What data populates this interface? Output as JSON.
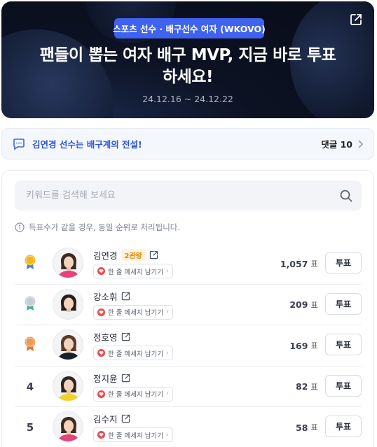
{
  "hero": {
    "category": "스포츠 선수 · 배구선수 여자 (WKOVO)",
    "title_line1": "팬들이 뽑는 여자 배구 MVP, 지금 바로 투표",
    "title_line2": "하세요!",
    "dates": "24.12.16 ~ 24.12.22"
  },
  "comment_bar": {
    "text": "김연경 선수는 배구계의 전설!",
    "count_label": "댓글 10"
  },
  "search": {
    "placeholder": "키워드를 검색해 보세요",
    "value": ""
  },
  "notice": "득표수가 같을 경우, 동일 순위로 처리됩니다.",
  "vote_label": "투표",
  "message_label": "한 줄 메세지 남기기",
  "vote_unit": "표",
  "players": [
    {
      "rank": "1",
      "medal": "gold",
      "name": "김연경",
      "tag": "2관왕",
      "votes": "1,057"
    },
    {
      "rank": "2",
      "medal": "silver",
      "name": "강소휘",
      "tag": "",
      "votes": "209"
    },
    {
      "rank": "3",
      "medal": "bronze",
      "name": "정호영",
      "tag": "",
      "votes": "169"
    },
    {
      "rank": "4",
      "medal": "",
      "name": "정지윤",
      "tag": "",
      "votes": "82"
    },
    {
      "rank": "5",
      "medal": "",
      "name": "김수지",
      "tag": "",
      "votes": "58"
    }
  ],
  "colors": {
    "accent": "#3f63ee",
    "link": "#2d55d6",
    "gold": "#f2b61c",
    "silver": "#c5cad3",
    "bronze": "#ec9a5a",
    "heart": "#f0474d"
  }
}
